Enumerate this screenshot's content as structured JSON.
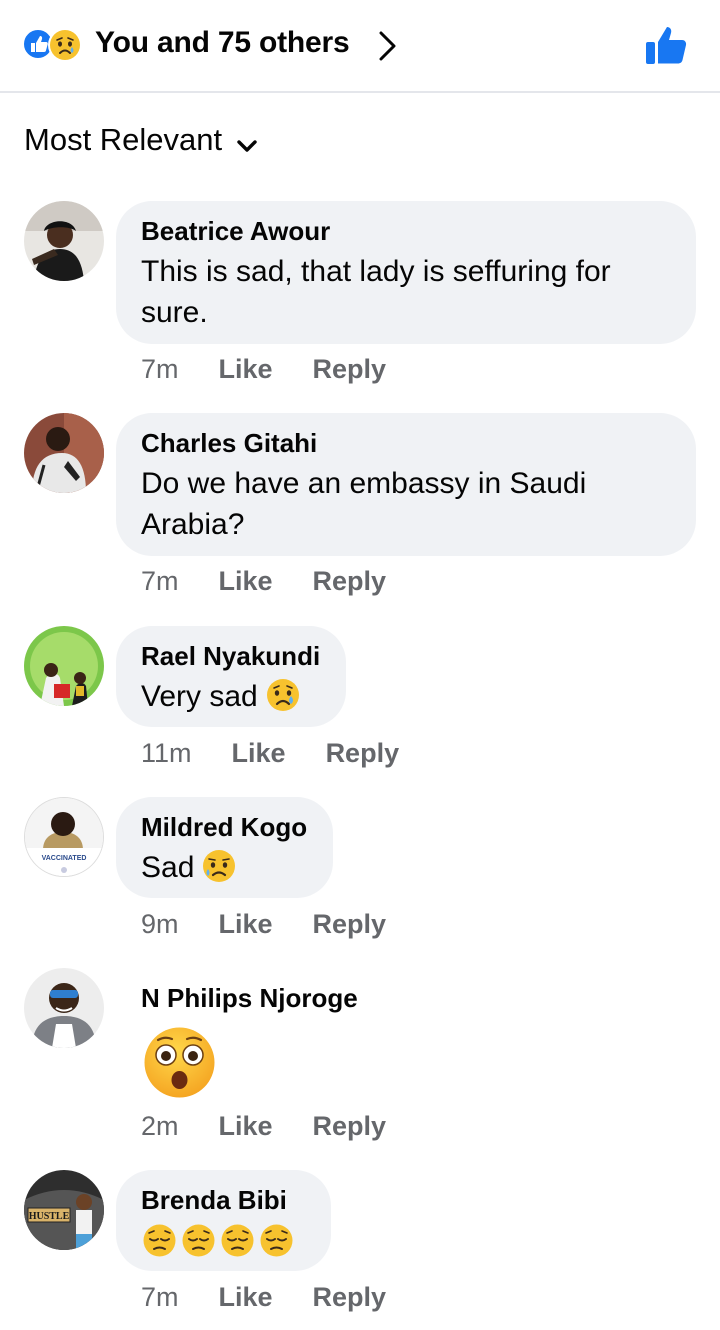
{
  "header": {
    "summary": "You and 75 others",
    "icons": [
      "like-reaction-icon",
      "sad-reaction-icon",
      "chevron-right-icon",
      "thumbs-up-icon"
    ],
    "accent_color": "#1877f2"
  },
  "sort": {
    "label": "Most Relevant",
    "icon": "chevron-down-icon"
  },
  "comments": [
    {
      "name": "Beatrice Awour",
      "text": "This is sad, that lady is seffuring for sure.",
      "time": "7m",
      "like": "Like",
      "reply": "Reply"
    },
    {
      "name": "Charles Gitahi",
      "text": "Do we have an embassy in Saudi Arabia?",
      "time": "7m",
      "like": "Like",
      "reply": "Reply"
    },
    {
      "name": "Rael Nyakundi",
      "text": "Very sad",
      "emoji": "crying-face-emoji",
      "time": "11m",
      "like": "Like",
      "reply": "Reply"
    },
    {
      "name": "Mildred Kogo",
      "text": "Sad",
      "emoji": "sad-but-relieved-face-emoji",
      "avatar_badge": "VACCINATED",
      "time": "9m",
      "like": "Like",
      "reply": "Reply"
    },
    {
      "name": "N Philips Njoroge",
      "emoji": "flushed-face-emoji",
      "time": "2m",
      "like": "Like",
      "reply": "Reply"
    },
    {
      "name": "Brenda Bibi",
      "emoji": "pensive-face-emoji",
      "emoji_count": 4,
      "avatar_badge": "HUSTLE",
      "time": "7m",
      "like": "Like",
      "reply": "Reply"
    }
  ]
}
